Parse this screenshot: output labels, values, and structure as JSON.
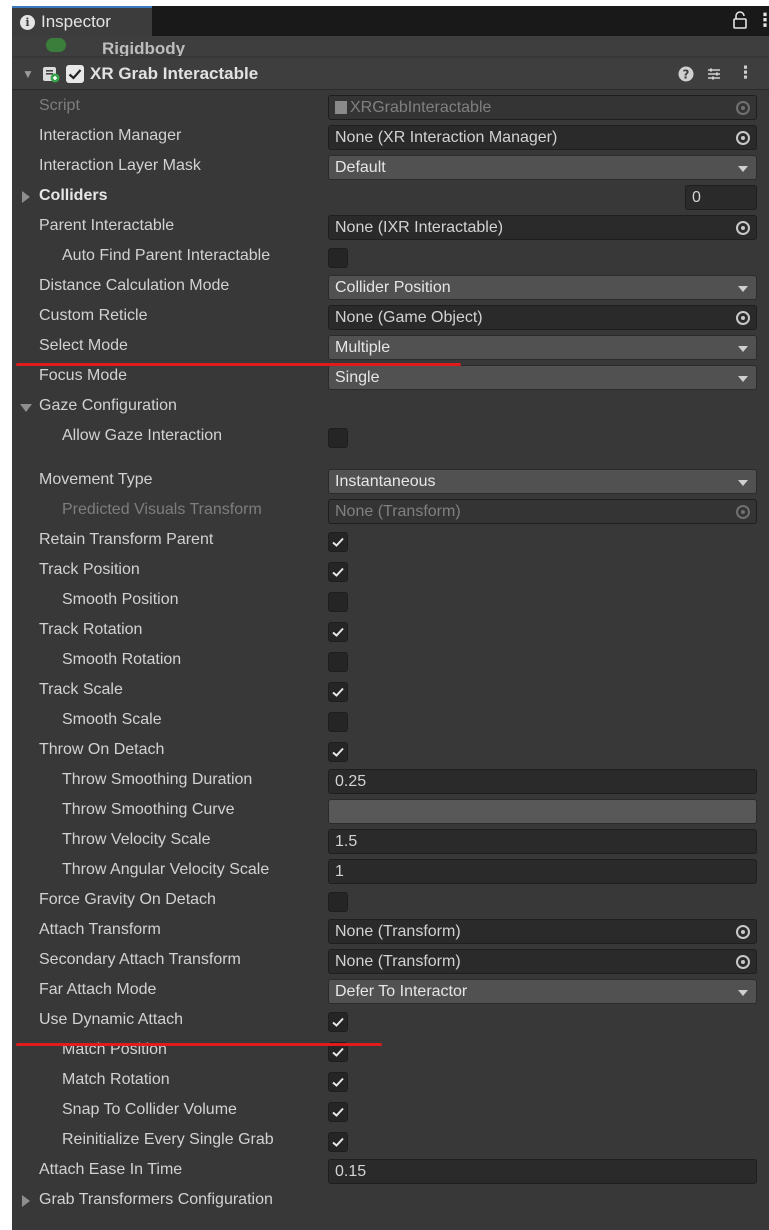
{
  "window": {
    "tab_title": "Inspector",
    "info_icon": "info-icon",
    "lock_icon": "lock-icon",
    "menu_icon": "kebab-menu-icon"
  },
  "prev_component": {
    "title": "Rigidbody"
  },
  "component": {
    "title": "XR Grab Interactable",
    "enabled": true,
    "colliders_count": "0"
  },
  "properties": [
    {
      "label": "Script",
      "type": "object",
      "value": "XRGrabInteractable",
      "disabled": true,
      "icon": "script-icon"
    },
    {
      "label": "Interaction Manager",
      "type": "object",
      "value": "None (XR Interaction Manager)"
    },
    {
      "label": "Interaction Layer Mask",
      "type": "dropdown",
      "value": "Default"
    },
    {
      "label": "Colliders",
      "type": "list",
      "value": "0",
      "bold": true
    },
    {
      "label": "Parent Interactable",
      "type": "object",
      "value": "None (IXR Interactable)"
    },
    {
      "label": "Auto Find Parent Interactable",
      "type": "toggle",
      "checked": false,
      "indent": true
    },
    {
      "label": "Distance Calculation Mode",
      "type": "dropdown",
      "value": "Collider Position"
    },
    {
      "label": "Custom Reticle",
      "type": "object",
      "value": "None (Game Object)"
    },
    {
      "label": "Select Mode",
      "type": "dropdown",
      "value": "Multiple"
    },
    {
      "label": "Focus Mode",
      "type": "dropdown",
      "value": "Single"
    },
    {
      "label": "Gaze Configuration",
      "type": "foldout",
      "expanded": true
    },
    {
      "label": "Allow Gaze Interaction",
      "type": "toggle",
      "checked": false,
      "indent": true
    },
    {
      "label": "Movement Type",
      "type": "dropdown",
      "value": "Instantaneous"
    },
    {
      "label": "Predicted Visuals Transform",
      "type": "object",
      "value": "None (Transform)",
      "disabled": true,
      "indent": true
    },
    {
      "label": "Retain Transform Parent",
      "type": "toggle",
      "checked": true
    },
    {
      "label": "Track Position",
      "type": "toggle",
      "checked": true
    },
    {
      "label": "Smooth Position",
      "type": "toggle",
      "checked": false,
      "indent": true
    },
    {
      "label": "Track Rotation",
      "type": "toggle",
      "checked": true
    },
    {
      "label": "Smooth Rotation",
      "type": "toggle",
      "checked": false,
      "indent": true
    },
    {
      "label": "Track Scale",
      "type": "toggle",
      "checked": true
    },
    {
      "label": "Smooth Scale",
      "type": "toggle",
      "checked": false,
      "indent": true
    },
    {
      "label": "Throw On Detach",
      "type": "toggle",
      "checked": true
    },
    {
      "label": "Throw Smoothing Duration",
      "type": "number",
      "value": "0.25",
      "indent": true
    },
    {
      "label": "Throw Smoothing Curve",
      "type": "curve",
      "indent": true
    },
    {
      "label": "Throw Velocity Scale",
      "type": "number",
      "value": "1.5",
      "indent": true
    },
    {
      "label": "Throw Angular Velocity Scale",
      "type": "number",
      "value": "1",
      "indent": true
    },
    {
      "label": "Force Gravity On Detach",
      "type": "toggle",
      "checked": false
    },
    {
      "label": "Attach Transform",
      "type": "object",
      "value": "None (Transform)"
    },
    {
      "label": "Secondary Attach Transform",
      "type": "object",
      "value": "None (Transform)"
    },
    {
      "label": "Far Attach Mode",
      "type": "dropdown",
      "value": "Defer To Interactor"
    },
    {
      "label": "Use Dynamic Attach",
      "type": "toggle",
      "checked": true
    },
    {
      "label": "Match Position",
      "type": "toggle",
      "checked": true,
      "indent": true
    },
    {
      "label": "Match Rotation",
      "type": "toggle",
      "checked": true,
      "indent": true
    },
    {
      "label": "Snap To Collider Volume",
      "type": "toggle",
      "checked": true,
      "indent": true
    },
    {
      "label": "Reinitialize Every Single Grab",
      "type": "toggle",
      "checked": true,
      "indent": true
    },
    {
      "label": "Attach Ease In Time",
      "type": "number",
      "value": "0.15"
    },
    {
      "label": "Grab Transformers Configuration",
      "type": "foldout",
      "expanded": false
    }
  ],
  "annotation_color": "#e01b1b"
}
